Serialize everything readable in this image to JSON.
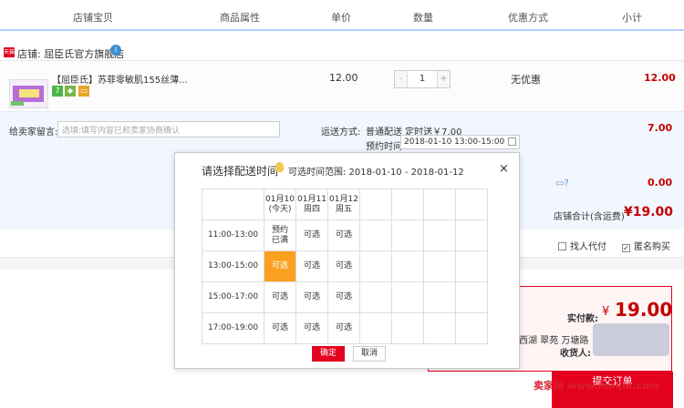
{
  "header": {
    "col_item": "店铺宝贝",
    "col_attr": "商品属性",
    "col_price": "单价",
    "col_qty": "数量",
    "col_discount": "优惠方式",
    "col_subtotal": "小计"
  },
  "shop": {
    "badge": "天猫",
    "name": "店铺: 屈臣氏官方旗舰店"
  },
  "item": {
    "title": "【屈臣氏】苏菲零敏肌155丝薄...",
    "price": "12.00",
    "qty": "1",
    "qty_minus": "-",
    "qty_plus": "+",
    "discount": "无优惠",
    "subtotal": "12.00"
  },
  "order": {
    "message_label": "给卖家留言:",
    "message_placeholder": "选填:填写内容已和卖家协商确认",
    "shipping_label": "运送方式:",
    "shipping_value": "普通配送 定时送￥7.00",
    "shipping_fee": "7.00",
    "delivery_label": "预约时间",
    "delivery_value": "2018-01-10 13:00-15:00",
    "other_fee": "0.00",
    "shop_total_label": "店铺合计(含运费)",
    "shop_total_value": "¥19.00",
    "proxy_pay": "找人代付",
    "anonymous": "匿名购买"
  },
  "payment": {
    "label": "实付款:",
    "currency": "¥",
    "value": "19.00",
    "address": "西湖 翠苑 万塘路",
    "receiver_label": "收货人:",
    "submit": "提交订单"
  },
  "watermark": "卖家网 www.maijia.com",
  "modal": {
    "title": "请选择配送时间",
    "range": "可选时间范围: 2018-01-10 - 2018-01-12",
    "close": "×",
    "days": [
      {
        "date": "01月10",
        "week": "(今天)"
      },
      {
        "date": "01月11",
        "week": "周四"
      },
      {
        "date": "01月12",
        "week": "周五"
      }
    ],
    "slots": [
      {
        "time": "11:00-13:00",
        "cells": [
          "预约已满",
          "可选",
          "可选"
        ]
      },
      {
        "time": "13:00-15:00",
        "cells": [
          "可选",
          "可选",
          "可选"
        ]
      },
      {
        "time": "15:00-17:00",
        "cells": [
          "可选",
          "可选",
          "可选"
        ]
      },
      {
        "time": "17:00-19:00",
        "cells": [
          "可选",
          "可选",
          "可选"
        ]
      }
    ],
    "selected": {
      "slot": 1,
      "day": 0
    },
    "confirm": "确定",
    "cancel": "取消"
  }
}
